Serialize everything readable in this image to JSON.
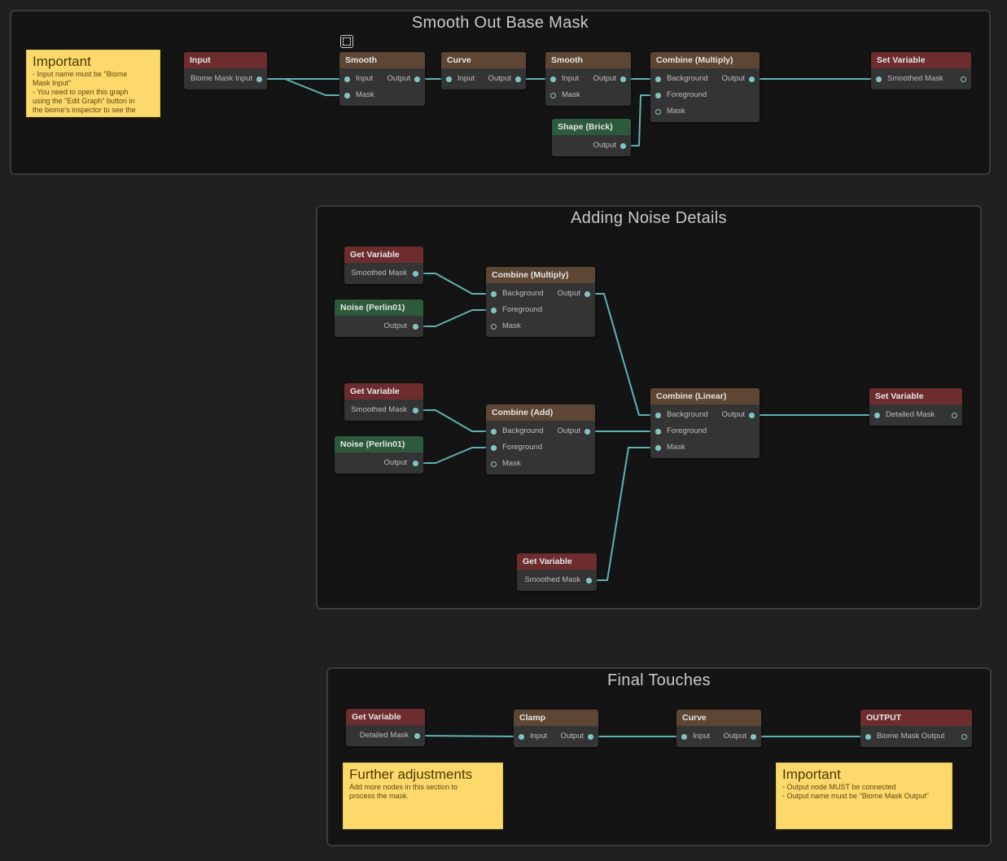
{
  "groups": {
    "smooth": "Smooth Out Base Mask",
    "noise": "Adding Noise Details",
    "final": "Final Touches"
  },
  "notes": {
    "important1": {
      "title": "Important",
      "body": "- Input name must be \"Biome\nMask Input\"\n- You need to open this graph\nusing the \"Edit Graph\" button in\nthe biome's inspector to see the"
    },
    "further": {
      "title": "Further adjustments",
      "body": "Add more nodes in this section to\nprocess the mask."
    },
    "important2": {
      "title": "Important",
      "body": "- Output node MUST be connected\n- Output name must be \"Biome Mask Output\""
    }
  },
  "nodes": {
    "input": {
      "title": "Input",
      "out": "Biome Mask Input"
    },
    "smooth1": {
      "title": "Smooth",
      "in": "Input",
      "out": "Output",
      "mask": "Mask"
    },
    "curve1": {
      "title": "Curve",
      "in": "Input",
      "out": "Output"
    },
    "smooth2": {
      "title": "Smooth",
      "in": "Input",
      "out": "Output",
      "mask": "Mask"
    },
    "combine1": {
      "title": "Combine (Multiply)",
      "bg": "Background",
      "out": "Output",
      "fg": "Foreground",
      "mask": "Mask"
    },
    "shape": {
      "title": "Shape (Brick)",
      "out": "Output"
    },
    "setvar1": {
      "title": "Set Variable",
      "in": "Smoothed Mask"
    },
    "getvar1": {
      "title": "Get Variable",
      "out": "Smoothed Mask"
    },
    "noise1": {
      "title": "Noise (Perlin01)",
      "out": "Output"
    },
    "combine2": {
      "title": "Combine (Multiply)",
      "bg": "Background",
      "out": "Output",
      "fg": "Foreground",
      "mask": "Mask"
    },
    "getvar2": {
      "title": "Get Variable",
      "out": "Smoothed Mask"
    },
    "noise2": {
      "title": "Noise (Perlin01)",
      "out": "Output"
    },
    "combine3": {
      "title": "Combine (Add)",
      "bg": "Background",
      "out": "Output",
      "fg": "Foreground",
      "mask": "Mask"
    },
    "linear": {
      "title": "Combine (Linear)",
      "bg": "Background",
      "out": "Output",
      "fg": "Foreground",
      "mask": "Mask"
    },
    "setvar2": {
      "title": "Set Variable",
      "in": "Detailed Mask"
    },
    "getvar3": {
      "title": "Get Variable",
      "out": "Smoothed Mask"
    },
    "getvar4": {
      "title": "Get Variable",
      "out": "Detailed Mask"
    },
    "clamp": {
      "title": "Clamp",
      "in": "Input",
      "out": "Output"
    },
    "curve2": {
      "title": "Curve",
      "in": "Input",
      "out": "Output"
    },
    "output": {
      "title": "OUTPUT",
      "in": "Biome Mask Output"
    }
  },
  "colors": {
    "wire": "#5fb3b3",
    "header_operation": "#5d4634",
    "header_variable": "#6d2d2e",
    "header_generator": "#2c5a3b",
    "note": "#fdd96b"
  }
}
